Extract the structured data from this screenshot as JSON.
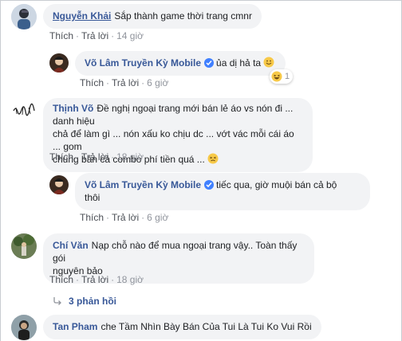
{
  "comments": [
    {
      "author": "Nguyễn Khải",
      "text": "Sắp thành game thời trang cmnr",
      "actions": {
        "like": "Thích",
        "reply": "Trả lời",
        "time": "14 giờ"
      }
    },
    {
      "author": "Võ Lâm Truyền Kỳ Mobile",
      "text": "ủa dị hả ta",
      "actions": {
        "like": "Thích",
        "reply": "Trả lời",
        "time": "6 giờ"
      },
      "reaction_count": "1"
    },
    {
      "author": "Thịnh Võ",
      "text_lines": [
        "Đề nghị ngoại trang mới bán lẻ áo vs nón đi ... danh hiệu",
        "chả để làm gì ... nón xấu ko chịu dc ... vớt vác mỗi cái áo ... gom",
        "chung bán cả combo phí tiền quá ..."
      ],
      "actions": {
        "like": "Thích",
        "reply": "Trả lời",
        "time": "18 giờ"
      }
    },
    {
      "author": "Võ Lâm Truyền Kỳ Mobile",
      "text_lines": [
        "tiếc qua, giờ muội bán cả bộ",
        "thôi"
      ],
      "actions": {
        "like": "Thích",
        "reply": "Trả lời",
        "time": "6 giờ"
      }
    },
    {
      "author": "Chí Văn",
      "text_lines": [
        "Nạp chỗ nào để mua ngoại trang vậy.. Toàn thấy gói",
        "nguyên bảo"
      ],
      "actions": {
        "like": "Thích",
        "reply": "Trả lời",
        "time": "18 giờ"
      },
      "replies": "3 phản hồi"
    },
    {
      "author": "Tan Pham",
      "text": "che Tầm Nhìn Bày Bán Của Tui Là Tui Ko Vui Rồi"
    }
  ],
  "separator": "·",
  "colors": {
    "link": "#385898",
    "verified": "#4080ff",
    "bubble": "#f2f3f5",
    "meta": "#90949c"
  }
}
